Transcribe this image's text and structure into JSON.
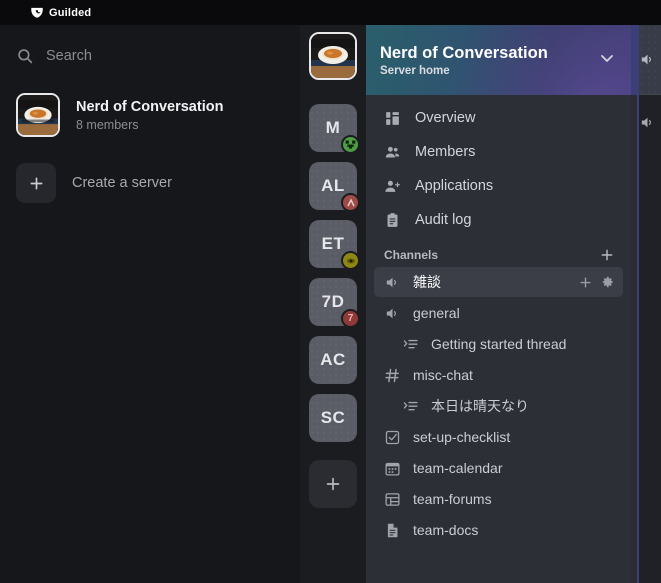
{
  "titlebar": {
    "brand": "Guilded",
    "logo_icon": "guilded-shield-icon"
  },
  "left_panel": {
    "search": {
      "placeholder": "Search",
      "icon": "search-icon"
    },
    "server": {
      "name": "Nerd of Conversation",
      "members": "8 members",
      "avatar_icon": "ramen-bowl-avatar"
    },
    "create_server": {
      "label": "Create a server",
      "icon": "plus-icon"
    }
  },
  "rail": {
    "home": {
      "initials": "",
      "avatar_icon": "ramen-bowl-avatar",
      "selected": true
    },
    "items": [
      {
        "initials": "M",
        "badge": "creeper-face",
        "badge_color": "#4f9e46"
      },
      {
        "initials": "AL",
        "badge": "arrow-mark",
        "badge_color": "#9e4a46"
      },
      {
        "initials": "ET",
        "badge": "eye-mark",
        "badge_color": "#8f8715"
      },
      {
        "initials": "7D",
        "badge": "7",
        "badge_color": "#8f3a38"
      },
      {
        "initials": "AC",
        "badge": "",
        "badge_color": ""
      },
      {
        "initials": "SC",
        "badge": "",
        "badge_color": ""
      }
    ],
    "add_server": {
      "label": "+",
      "icon": "plus-icon"
    }
  },
  "sidebar": {
    "header": {
      "title": "Nerd of Conversation",
      "subtitle": "Server home",
      "chevron_icon": "chevron-down-icon",
      "gradient_from": "#2a5f6b",
      "gradient_to": "#3c3a6d"
    },
    "nav": [
      {
        "label": "Overview",
        "icon": "overview-icon"
      },
      {
        "label": "Members",
        "icon": "members-icon"
      },
      {
        "label": "Applications",
        "icon": "applications-icon"
      },
      {
        "label": "Audit log",
        "icon": "audit-log-icon"
      }
    ],
    "channels_section": {
      "title": "Channels",
      "add_icon": "plus-icon"
    },
    "channels": [
      {
        "name": "雑談",
        "type": "voice",
        "selected": true,
        "thread": false,
        "add_label": "+",
        "settings_icon": "gear-icon"
      },
      {
        "name": "general",
        "type": "voice",
        "selected": false,
        "thread": false
      },
      {
        "name": "Getting started thread",
        "type": "thread",
        "selected": false,
        "thread": true
      },
      {
        "name": "misc-chat",
        "type": "text",
        "selected": false,
        "thread": false
      },
      {
        "name": "本日は晴天なり",
        "type": "thread",
        "selected": false,
        "thread": true
      },
      {
        "name": "set-up-checklist",
        "type": "list",
        "selected": false,
        "thread": false
      },
      {
        "name": "team-calendar",
        "type": "calendar",
        "selected": false,
        "thread": false
      },
      {
        "name": "team-forums",
        "type": "forum",
        "selected": false,
        "thread": false
      },
      {
        "name": "team-docs",
        "type": "doc",
        "selected": false,
        "thread": false
      }
    ]
  },
  "right_peek": {
    "rows": [
      {
        "icon": "voice-channel-icon"
      },
      {
        "icon": "voice-channel-icon"
      }
    ]
  }
}
